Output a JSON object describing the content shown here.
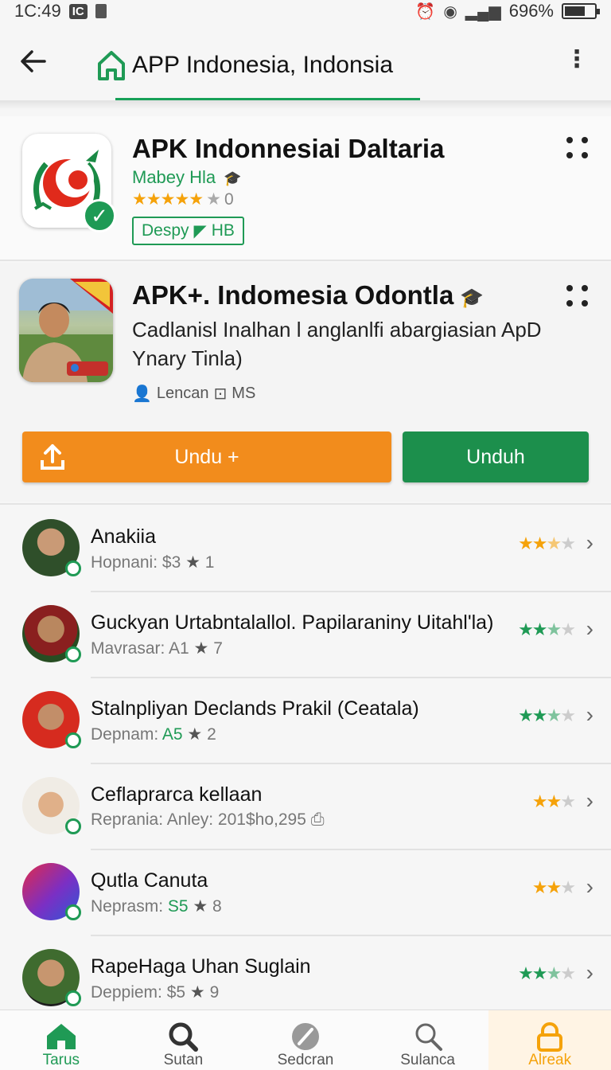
{
  "status_bar": {
    "time": "1C:49",
    "badge": "IC",
    "battery_text": "696%",
    "battery_level": 0.69
  },
  "appbar": {
    "title": "APP Indonesia, Indonsia"
  },
  "app1": {
    "title": "APK Indonnesiai Daltaria",
    "developer": "Mabey Hla",
    "stars": "★★★★★",
    "rating_count": "0",
    "tag": "Despy",
    "tag_suffix": "HB"
  },
  "app2": {
    "title": "APK+. Indomesia Odontla",
    "description": "Cadlanisl Inalhan l anglanlfi abargiasian ApD Ynary Tinla)",
    "meta_author": "Lencan",
    "meta_size": "MS",
    "btn_secondary": "Undu +",
    "btn_primary": "Unduh"
  },
  "list": [
    {
      "name": "Anakiia",
      "sub_prefix": "Hopnani: $3",
      "sub_count": "1",
      "stars_full": "★★",
      "stars_half": "★",
      "stars_empty": "★",
      "star_color": "#f5a20a"
    },
    {
      "name": "Guckyan Urtabntalallol. Papilaraniny Uitahl'la)",
      "sub_prefix": "Mavrasar: A1",
      "sub_count": "7",
      "stars_full": "★★",
      "stars_half": "★",
      "stars_empty": "★",
      "star_color": "#1f9a55"
    },
    {
      "name": "Stalnpliyan Declands Prakil (Ceatala)",
      "sub_prefix": "Depnam: ",
      "sub_value": "A5",
      "sub_count": "2",
      "stars_full": "★★",
      "stars_half": "★",
      "stars_empty": "★",
      "star_color": "#1f9a55"
    },
    {
      "name": "Ceflaprarca kellaan",
      "sub_prefix": "Reprania: Anley: 201$ho,295",
      "sub_count": "",
      "stars_full": "★★",
      "stars_half": "",
      "stars_empty": "★",
      "star_color": "#f5a20a"
    },
    {
      "name": "Qutla Canuta",
      "sub_prefix": "Neprasm: ",
      "sub_value": "S5",
      "sub_count": "8",
      "stars_full": "★★",
      "stars_half": "",
      "stars_empty": "★",
      "star_color": "#f5a20a"
    },
    {
      "name": "RapeHaga Uhan Suglain",
      "sub_prefix": "Deppiem: $5",
      "sub_count": "9",
      "stars_full": "★★",
      "stars_half": "★",
      "stars_empty": "★",
      "star_color": "#1f9a55"
    }
  ],
  "bottom_nav": [
    {
      "label": "Tarus",
      "icon": "home-icon"
    },
    {
      "label": "Sutan",
      "icon": "zoom-search-icon"
    },
    {
      "label": "Sedcran",
      "icon": "slash-circle-icon"
    },
    {
      "label": "Sulanca",
      "icon": "search-icon"
    },
    {
      "label": "Alreak",
      "icon": "lock-icon"
    }
  ],
  "colors": {
    "brand_green": "#1f9a55",
    "accent_orange": "#f28c1c",
    "primary_button": "#1c8f4c"
  }
}
